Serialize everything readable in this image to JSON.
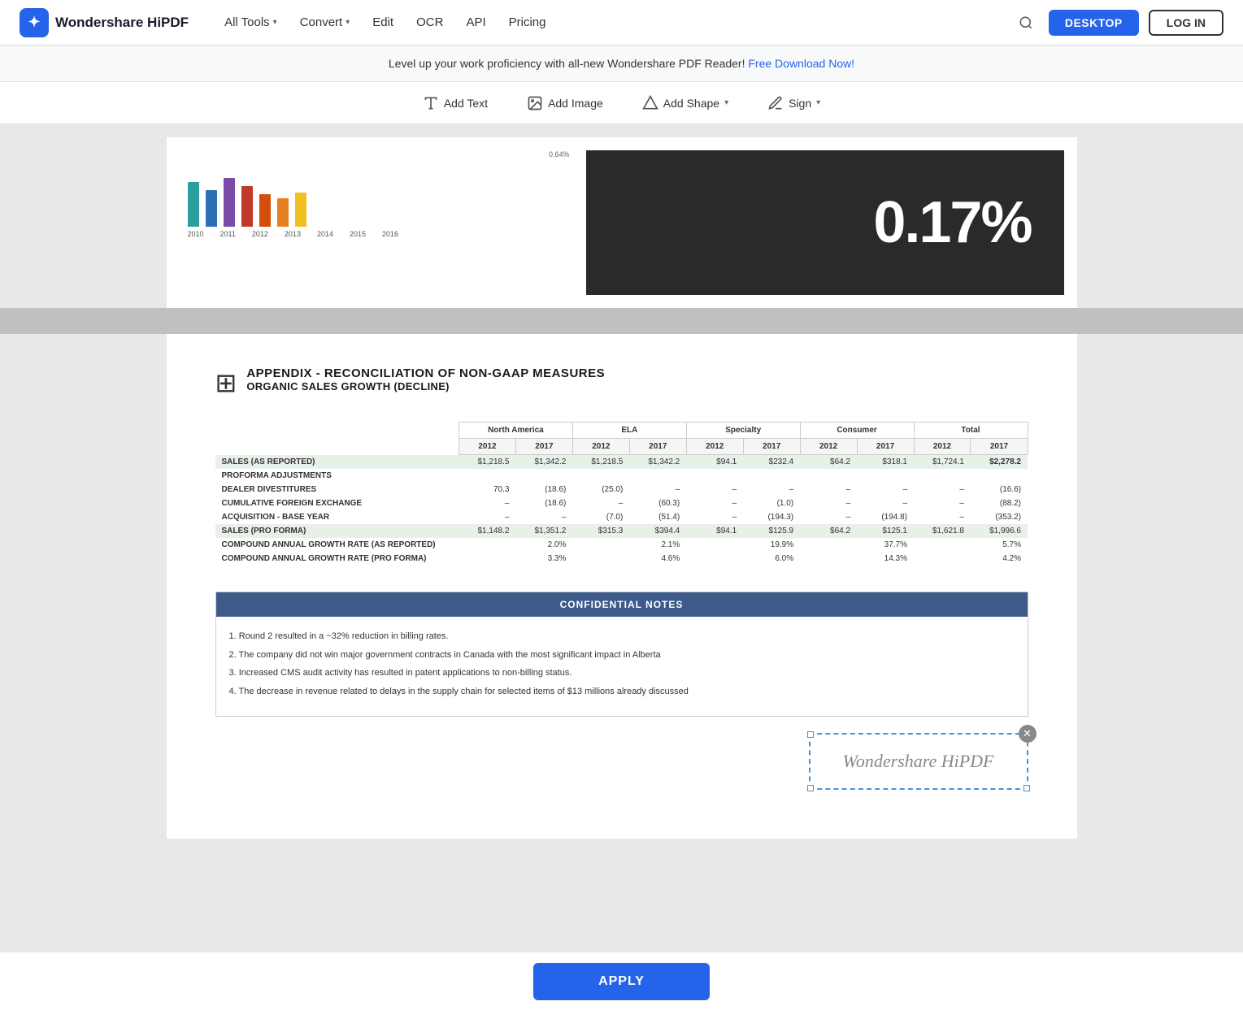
{
  "header": {
    "logo_icon": "✦",
    "logo_text": "Wondershare HiPDF",
    "nav": [
      {
        "label": "All Tools",
        "has_chevron": true
      },
      {
        "label": "Convert",
        "has_chevron": true
      },
      {
        "label": "Edit",
        "has_chevron": false
      },
      {
        "label": "OCR",
        "has_chevron": false
      },
      {
        "label": "API",
        "has_chevron": false
      },
      {
        "label": "Pricing",
        "has_chevron": false
      }
    ],
    "btn_desktop": "DESKTOP",
    "btn_login": "LOG IN"
  },
  "announcement": {
    "text": "Level up your work proficiency with all-new Wondershare PDF Reader!",
    "link_text": "Free Download Now!"
  },
  "toolbar": {
    "add_text_label": "Add Text",
    "add_image_label": "Add Image",
    "add_shape_label": "Add Shape",
    "sign_label": "Sign"
  },
  "page": {
    "image_overlay_text": "0.17%",
    "chart_years": [
      "2010",
      "2011",
      "2012",
      "2013",
      "2014",
      "2015",
      "2016"
    ],
    "chart_colors": [
      "#2d9e9e",
      "#2d6db5",
      "#7b4ba8",
      "#c0392b",
      "#d44d0a",
      "#e67e22"
    ],
    "appendix_title1": "APPENDIX - RECONCILIATION OF NON-GAAP MEASURES",
    "appendix_title2": "ORGANIC SALES GROWTH (DECLINE)",
    "table": {
      "col_groups": [
        "North America",
        "ELA",
        "Specialty",
        "Consumer",
        "Total"
      ],
      "years": [
        "2012",
        "2017",
        "2012",
        "2017",
        "2012",
        "2017",
        "2012",
        "2017",
        "2012",
        "2017"
      ],
      "rows": [
        {
          "label": "SALES (AS REPORTED)",
          "shaded": true,
          "values": [
            "$1,218.5",
            "$1,342.2",
            "$1,218.5",
            "$1,342.2",
            "$94.1",
            "$232.4",
            "$64.2",
            "$318.1",
            "$1,724.1",
            "$2,278.2"
          ]
        },
        {
          "label": "PROFORMA ADJUSTMENTS",
          "shaded": false,
          "values": [
            "",
            "",
            "",
            "",
            "",
            "",
            "",
            "",
            "",
            ""
          ]
        },
        {
          "label": "DEALER DIVESTITURES",
          "shaded": false,
          "values": [
            "70.3",
            "(18.6)",
            "(25.0)",
            "–",
            "–",
            "–",
            "–",
            "–",
            "–",
            "(16.6)"
          ]
        },
        {
          "label": "CUMULATIVE FOREIGN EXCHANGE",
          "shaded": false,
          "values": [
            "–",
            "(18.6)",
            "–",
            "(60.3)",
            "–",
            "(1.0)",
            "–",
            "–",
            "–",
            "(88.2)"
          ]
        },
        {
          "label": "ACQUISITION - BASE YEAR",
          "shaded": false,
          "values": [
            "–",
            "–",
            "(7.0)",
            "(51.4)",
            "–",
            "(194.3)",
            "–",
            "(194.8)",
            "–",
            "(353.2)"
          ]
        },
        {
          "label": "SALES (PRO FORMA)",
          "shaded": true,
          "values": [
            "$1,148.2",
            "$1,351.2",
            "$315.3",
            "$394.4",
            "$94.1",
            "$125.9",
            "$64.2",
            "$125.1",
            "$1,621.8",
            "$1,996.6"
          ]
        },
        {
          "label": "COMPOUND ANNUAL GROWTH RATE (AS REPORTED)",
          "shaded": false,
          "values": [
            "",
            "2.0%",
            "",
            "2.1%",
            "",
            "19.9%",
            "",
            "37.7%",
            "",
            "5.7%"
          ]
        },
        {
          "label": "COMPOUND ANNUAL GROWTH RATE (PRO FORMA)",
          "shaded": false,
          "values": [
            "",
            "3.3%",
            "",
            "4.6%",
            "",
            "6.0%",
            "",
            "14.3%",
            "",
            "4.2%"
          ]
        }
      ]
    },
    "confidential_header": "CONFIDENTIAL NOTES",
    "confidential_notes": [
      "1. Round 2 resulted in a ~32% reduction in billing rates.",
      "2. The company did not win major government contracts in Canada with the most significant impact in Alberta",
      "3. Increased CMS audit activity has resulted in patent applications to non-billing status.",
      "4. The decrease in revenue related to delays in the supply chain for selected items of $13 millions already discussed"
    ],
    "signature_text": "Wondershare HiPDF"
  },
  "apply_button": "APPLY"
}
